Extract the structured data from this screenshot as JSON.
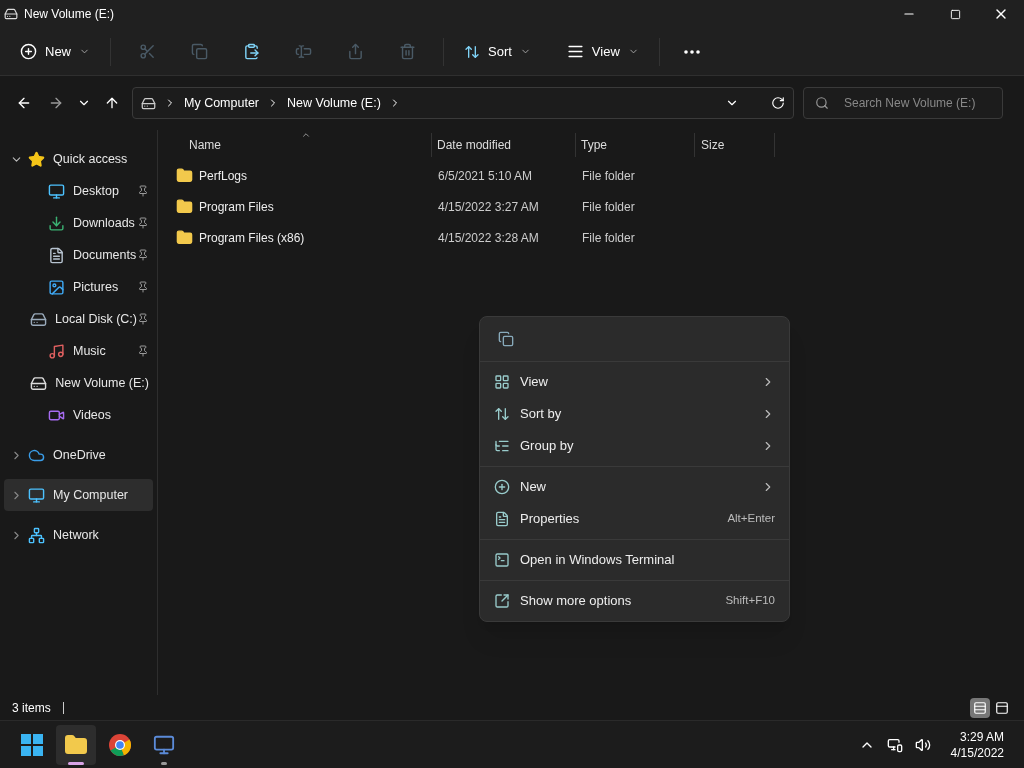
{
  "window": {
    "title": "New Volume (E:)"
  },
  "toolbar": {
    "new": {
      "label": "New"
    },
    "actions": [
      {
        "disabled": true
      },
      {
        "disabled": true
      },
      {
        "disabled": false
      },
      {
        "disabled": true
      },
      {
        "disabled": true
      },
      {
        "disabled": true
      }
    ],
    "sort": {
      "label": "Sort"
    },
    "view": {
      "label": "View"
    }
  },
  "address": {
    "crumbs": [
      "My Computer",
      "New Volume (E:)"
    ],
    "search_placeholder": "Search New Volume (E:)"
  },
  "sidebar": {
    "items": [
      {
        "label": "Quick access",
        "expanded": true,
        "selected": false,
        "children": [
          {
            "label": "Desktop",
            "pinned": true,
            "selected": false
          },
          {
            "label": "Downloads",
            "pinned": true,
            "selected": false
          },
          {
            "label": "Documents",
            "pinned": true,
            "selected": false
          },
          {
            "label": "Pictures",
            "pinned": true,
            "selected": false
          },
          {
            "label": "Local Disk (C:)",
            "pinned": true,
            "selected": false
          },
          {
            "label": "Music",
            "pinned": true,
            "selected": false
          },
          {
            "label": "New Volume (E:)",
            "pinned": false,
            "selected": false
          },
          {
            "label": "Videos",
            "pinned": false,
            "selected": false
          }
        ]
      },
      {
        "label": "OneDrive",
        "expanded": false,
        "selected": false
      },
      {
        "label": "My Computer",
        "expanded": false,
        "selected": true
      },
      {
        "label": "Network",
        "expanded": false,
        "selected": false
      }
    ]
  },
  "table": {
    "columns": [
      "Name",
      "Date modified",
      "Type",
      "Size"
    ],
    "rows": [
      {
        "name": "PerfLogs",
        "date": "6/5/2021 5:10 AM",
        "type": "File folder"
      },
      {
        "name": "Program Files",
        "date": "4/15/2022 3:27 AM",
        "type": "File folder"
      },
      {
        "name": "Program Files (x86)",
        "date": "4/15/2022 3:28 AM",
        "type": "File folder"
      }
    ]
  },
  "context_menu": {
    "groups": [
      [
        {
          "label": "View",
          "submenu": true
        },
        {
          "label": "Sort by",
          "submenu": true
        },
        {
          "label": "Group by",
          "submenu": true
        }
      ],
      [
        {
          "label": "New",
          "submenu": true
        },
        {
          "label": "Properties",
          "submenu": false,
          "shortcut": "Alt+Enter"
        }
      ],
      [
        {
          "label": "Open in Windows Terminal",
          "submenu": false
        }
      ],
      [
        {
          "label": "Show more options",
          "submenu": false,
          "shortcut": "Shift+F10"
        }
      ]
    ]
  },
  "status_bar": {
    "count": "3 items",
    "views": [
      {
        "selected": true
      },
      {
        "selected": false
      }
    ]
  },
  "taskbar": {
    "apps": [
      {
        "active": false,
        "running": false
      },
      {
        "active": true,
        "running": true
      },
      {
        "active": false,
        "running": false
      },
      {
        "active": false,
        "running": true
      }
    ],
    "time": "3:29 AM",
    "date": "4/15/2022"
  }
}
